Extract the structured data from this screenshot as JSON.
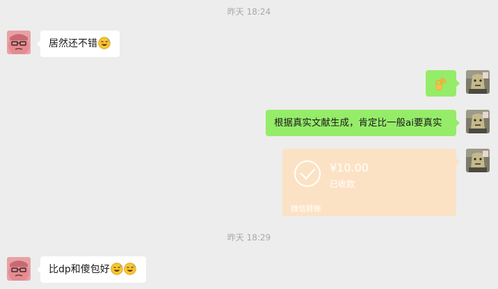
{
  "timestamps": [
    "昨天 18:24",
    "昨天 18:29"
  ],
  "messages": [
    {
      "side": "in",
      "text": "居然还不错",
      "emoji": "grinning-sweat-emoji"
    },
    {
      "side": "out",
      "text": "",
      "emoji": "ok-hand-emoji"
    },
    {
      "side": "out",
      "text": "根据真实文献生成，肯定比一般ai要真实",
      "emoji": ""
    },
    {
      "side": "in",
      "text": "比dp和傻包好",
      "emoji": "grinning-sweat-emoji x2"
    }
  ],
  "transfer": {
    "amount": "¥10.00",
    "status": "已收款",
    "label": "微信转账",
    "icon": "check-circle-icon"
  },
  "colors": {
    "background": "#ededed",
    "incoming_bubble": "#ffffff",
    "outgoing_bubble": "#95ec69",
    "transfer_card": "#fce2c4",
    "timestamp": "#a8a8a8"
  }
}
